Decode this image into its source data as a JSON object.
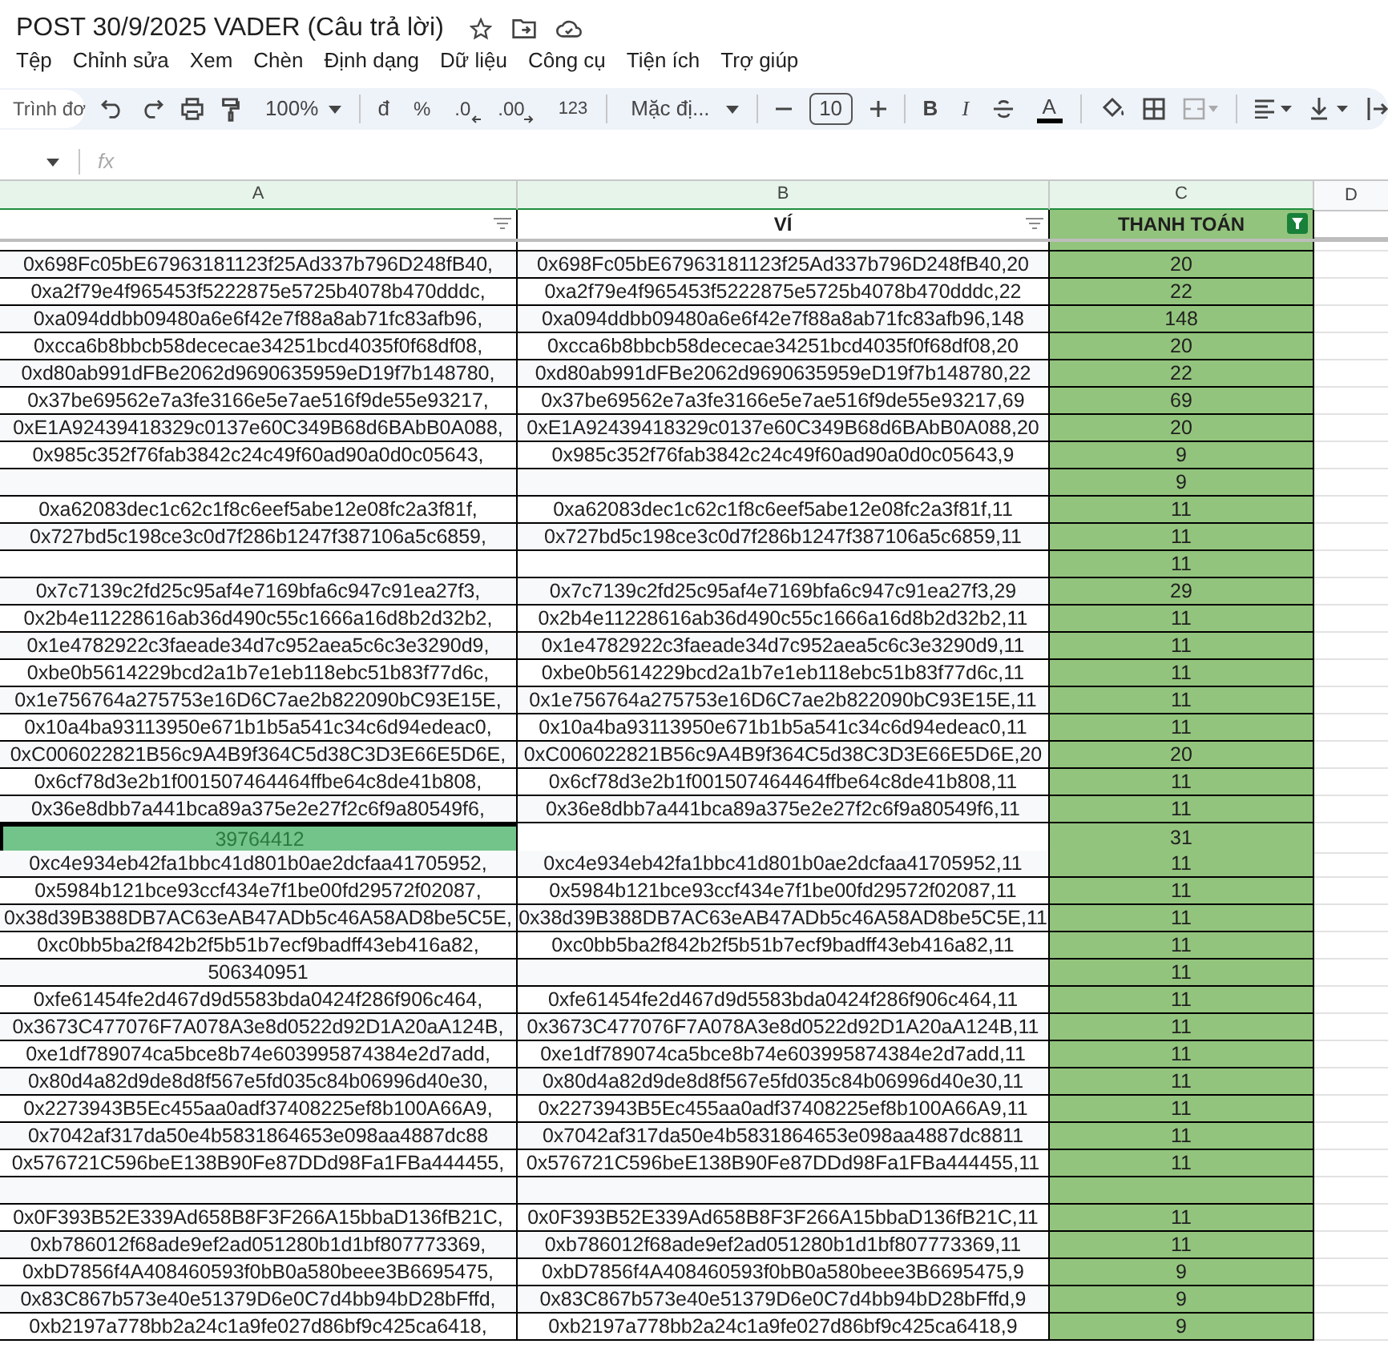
{
  "document": {
    "title": "POST 30/9/2025 VADER (Câu trả lời)"
  },
  "menu": [
    "Tệp",
    "Chỉnh sửa",
    "Xem",
    "Chèn",
    "Định dạng",
    "Dữ liệu",
    "Công cụ",
    "Tiện ích",
    "Trợ giúp"
  ],
  "toolbar": {
    "menu_search": "Trình đơ",
    "zoom": "100%",
    "currency": "đ",
    "percent": "%",
    "decrease_decimal": ".0",
    "increase_decimal": ".00",
    "number_format": "123",
    "font": "Mặc đị...",
    "font_size": "10",
    "bold": "B",
    "italic": "I",
    "text_color": "A"
  },
  "formula_bar": {
    "fx": "fx"
  },
  "columns": [
    "A",
    "B",
    "C",
    "D"
  ],
  "header_row": {
    "column_b": "VÍ",
    "column_c": "THANH TOÁN"
  },
  "filters": [
    {
      "active": false
    },
    {
      "active": false
    },
    {
      "active": true
    }
  ],
  "rows": [
    {
      "a": "0x698Fc05bE67963181123f25Ad337b796D248fB40,",
      "b": "0x698Fc05bE67963181123f25Ad337b796D248fB40,20",
      "c": "20",
      "selected": false
    },
    {
      "a": "0xa2f79e4f965453f5222875e5725b4078b470dddc,",
      "b": "0xa2f79e4f965453f5222875e5725b4078b470dddc,22",
      "c": "22",
      "selected": false
    },
    {
      "a": "0xa094ddbb09480a6e6f42e7f88a8ab71fc83afb96,",
      "b": "0xa094ddbb09480a6e6f42e7f88a8ab71fc83afb96,148",
      "c": "148",
      "selected": false
    },
    {
      "a": "0xcca6b8bbcb58dececae34251bcd4035f0f68df08,",
      "b": "0xcca6b8bbcb58dececae34251bcd4035f0f68df08,20",
      "c": "20",
      "selected": false
    },
    {
      "a": "0xd80ab991dFBe2062d9690635959eD19f7b148780,",
      "b": "0xd80ab991dFBe2062d9690635959eD19f7b148780,22",
      "c": "22",
      "selected": false
    },
    {
      "a": "0x37be69562e7a3fe3166e5e7ae516f9de55e93217,",
      "b": "0x37be69562e7a3fe3166e5e7ae516f9de55e93217,69",
      "c": "69",
      "selected": false
    },
    {
      "a": "0xE1A92439418329c0137e60C349B68d6BAbB0A088,",
      "b": "0xE1A92439418329c0137e60C349B68d6BAbB0A088,20",
      "c": "20",
      "selected": false
    },
    {
      "a": "0x985c352f76fab3842c24c49f60ad90a0d0c05643,",
      "b": "0x985c352f76fab3842c24c49f60ad90a0d0c05643,9",
      "c": "9",
      "selected": false
    },
    {
      "c": "9",
      "selected": false
    },
    {
      "a": "0xa62083dec1c62c1f8c6eef5abe12e08fc2a3f81f,",
      "b": "0xa62083dec1c62c1f8c6eef5abe12e08fc2a3f81f,11",
      "c": "11",
      "selected": false
    },
    {
      "a": "0x727bd5c198ce3c0d7f286b1247f387106a5c6859,",
      "b": "0x727bd5c198ce3c0d7f286b1247f387106a5c6859,11",
      "c": "11",
      "selected": false
    },
    {
      "c": "11",
      "selected": false
    },
    {
      "a": "0x7c7139c2fd25c95af4e7169bfa6c947c91ea27f3,",
      "b": "0x7c7139c2fd25c95af4e7169bfa6c947c91ea27f3,29",
      "c": "29",
      "selected": false
    },
    {
      "a": "0x2b4e11228616ab36d490c55c1666a16d8b2d32b2,",
      "b": "0x2b4e11228616ab36d490c55c1666a16d8b2d32b2,11",
      "c": "11",
      "selected": false
    },
    {
      "a": "0x1e4782922c3faeade34d7c952aea5c6c3e3290d9,",
      "b": "0x1e4782922c3faeade34d7c952aea5c6c3e3290d9,11",
      "c": "11",
      "selected": false
    },
    {
      "a": "0xbe0b5614229bcd2a1b7e1eb118ebc51b83f77d6c,",
      "b": "0xbe0b5614229bcd2a1b7e1eb118ebc51b83f77d6c,11",
      "c": "11",
      "selected": false
    },
    {
      "a": "0x1e756764a275753e16D6C7ae2b822090bC93E15E,",
      "b": "0x1e756764a275753e16D6C7ae2b822090bC93E15E,11",
      "c": "11",
      "selected": false
    },
    {
      "a": "0x10a4ba93113950e671b1b5a541c34c6d94edeac0,",
      "b": "0x10a4ba93113950e671b1b5a541c34c6d94edeac0,11",
      "c": "11",
      "selected": false
    },
    {
      "a": "0xC006022821B56c9A4B9f364C5d38C3D3E66E5D6E,",
      "b": "0xC006022821B56c9A4B9f364C5d38C3D3E66E5D6E,20",
      "c": "20",
      "selected": false
    },
    {
      "a": "0x6cf78d3e2b1f001507464464ffbe64c8de41b808,",
      "b": "0x6cf78d3e2b1f001507464464ffbe64c8de41b808,11",
      "c": "11",
      "selected": false
    },
    {
      "a": "0x36e8dbb7a441bca89a375e2e27f2c6f9a80549f6,",
      "b": "0x36e8dbb7a441bca89a375e2e27f2c6f9a80549f6,11",
      "c": "11",
      "selected": false
    },
    {
      "a": "39764412",
      "c": "31",
      "selected": true
    },
    {
      "a": "0xc4e934eb42fa1bbc41d801b0ae2dcfaa41705952,",
      "b": "0xc4e934eb42fa1bbc41d801b0ae2dcfaa41705952,11",
      "c": "11",
      "selected": false
    },
    {
      "a": "0x5984b121bce93ccf434e7f1be00fd29572f02087,",
      "b": "0x5984b121bce93ccf434e7f1be00fd29572f02087,11",
      "c": "11",
      "selected": false
    },
    {
      "a": "0x38d39B388DB7AC63eAB47ADb5c46A58AD8be5C5E,",
      "b": "0x38d39B388DB7AC63eAB47ADb5c46A58AD8be5C5E,11",
      "c": "11",
      "selected": false
    },
    {
      "a": "0xc0bb5ba2f842b2f5b51b7ecf9badff43eb416a82,",
      "b": "0xc0bb5ba2f842b2f5b51b7ecf9badff43eb416a82,11",
      "c": "11",
      "selected": false
    },
    {
      "a": "506340951",
      "c": "11",
      "selected": false
    },
    {
      "a": "0xfe61454fe2d467d9d5583bda0424f286f906c464,",
      "b": "0xfe61454fe2d467d9d5583bda0424f286f906c464,11",
      "c": "11",
      "selected": false
    },
    {
      "a": "0x3673C477076F7A078A3e8d0522d92D1A20aA124B,",
      "b": "0x3673C477076F7A078A3e8d0522d92D1A20aA124B,11",
      "c": "11",
      "selected": false
    },
    {
      "a": "0xe1df789074ca5bce8b74e603995874384e2d7add,",
      "b": "0xe1df789074ca5bce8b74e603995874384e2d7add,11",
      "c": "11",
      "selected": false
    },
    {
      "a": "0x80d4a82d9de8d8f567e5fd035c84b06996d40e30,",
      "b": "0x80d4a82d9de8d8f567e5fd035c84b06996d40e30,11",
      "c": "11",
      "selected": false
    },
    {
      "a": "0x2273943B5Ec455aa0adf37408225ef8b100A66A9,",
      "b": "0x2273943B5Ec455aa0adf37408225ef8b100A66A9,11",
      "c": "11",
      "selected": false
    },
    {
      "a": "0x7042af317da50e4b5831864653e098aa4887dc88",
      "b": "0x7042af317da50e4b5831864653e098aa4887dc8811",
      "c": "11",
      "selected": false
    },
    {
      "a": "0x576721C596beE138B90Fe87DDd98Fa1FBa444455,",
      "b": "0x576721C596beE138B90Fe87DDd98Fa1FBa444455,11",
      "c": "11",
      "selected": false
    },
    {
      "selected": false
    },
    {
      "a": "0x0F393B52E339Ad658B8F3F266A15bbaD136fB21C,",
      "b": "0x0F393B52E339Ad658B8F3F266A15bbaD136fB21C,11",
      "c": "11",
      "selected": false
    },
    {
      "a": "0xb786012f68ade9ef2ad051280b1d1bf807773369,",
      "b": "0xb786012f68ade9ef2ad051280b1d1bf807773369,11",
      "c": "11",
      "selected": false
    },
    {
      "a": "0xbD7856f4A408460593f0bB0a580beee3B6695475,",
      "b": "0xbD7856f4A408460593f0bB0a580beee3B6695475,9",
      "c": "9",
      "selected": false
    },
    {
      "a": "0x83C867b573e40e51379D6e0C7d4bb94bD28bFffd,",
      "b": "0x83C867b573e40e51379D6e0C7d4bb94bD28bFffd,9",
      "c": "9",
      "selected": false
    },
    {
      "a": "0xb2197a778bb2a24c1a9fe027d86bf9c425ca6418,",
      "b": "0xb2197a778bb2a24c1a9fe027d86bf9c425ca6418,9",
      "c": "9",
      "selected": false
    }
  ]
}
